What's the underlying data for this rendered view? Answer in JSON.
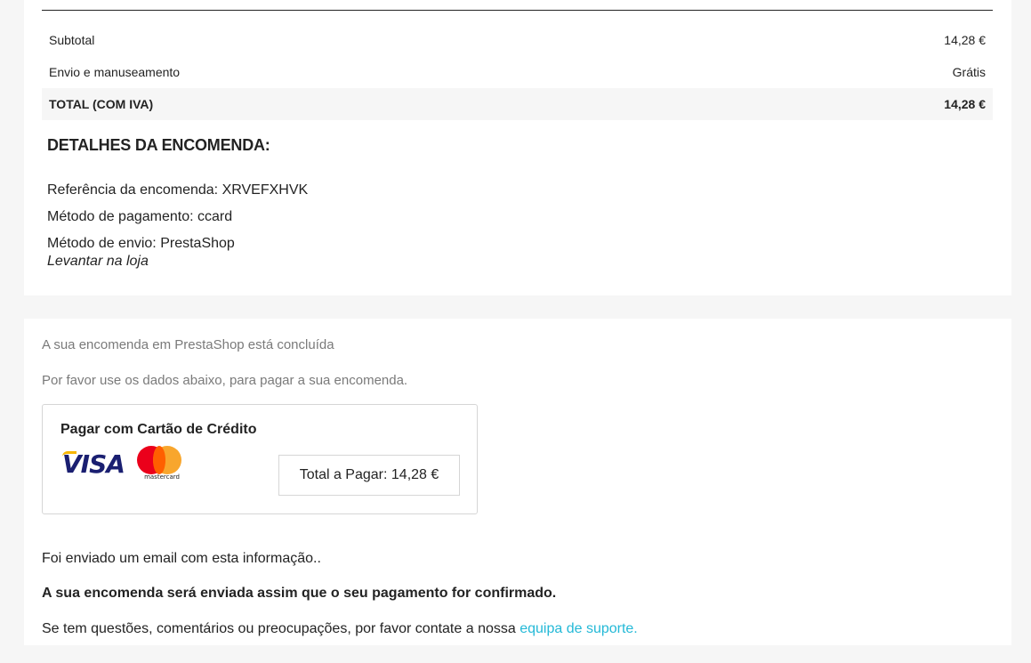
{
  "summary": {
    "rows": [
      {
        "label": "Subtotal",
        "value": "14,28 €"
      },
      {
        "label": "Envio e manuseamento",
        "value": "Grátis"
      }
    ],
    "total": {
      "label": "TOTAL (COM IVA)",
      "value": "14,28 €"
    }
  },
  "details": {
    "title": "DETALHES DA ENCOMENDA:",
    "reference": "Referência da encomenda: XRVEFXHVK",
    "payment_method": "Método de pagamento: ccard",
    "shipping_method": "Método de envio: PrestaShop",
    "shipping_note": "Levantar na loja"
  },
  "payment": {
    "status": "A sua encomenda em PrestaShop está concluída",
    "instructions": "Por favor use os dados abaixo, para pagar a sua encomenda.",
    "box_title": "Pagar com Cartão de Crédito",
    "visa_label": "VISA",
    "mastercard_label": "mastercard",
    "total_to_pay": "Total a Pagar: 14,28 €"
  },
  "messages": {
    "email_sent": "Foi enviado um email com esta informação..",
    "shipping_notice": "A sua encomenda será enviada assim que o seu pagamento for confirmado.",
    "questions_prefix": "Se tem questões, comentários ou preocupações, por favor contate a nossa ",
    "support_link": "equipa de suporte."
  },
  "colors": {
    "link": "#24b9d7",
    "text": "#232323",
    "muted": "#7a7a7a",
    "background": "#f6f6f6"
  }
}
